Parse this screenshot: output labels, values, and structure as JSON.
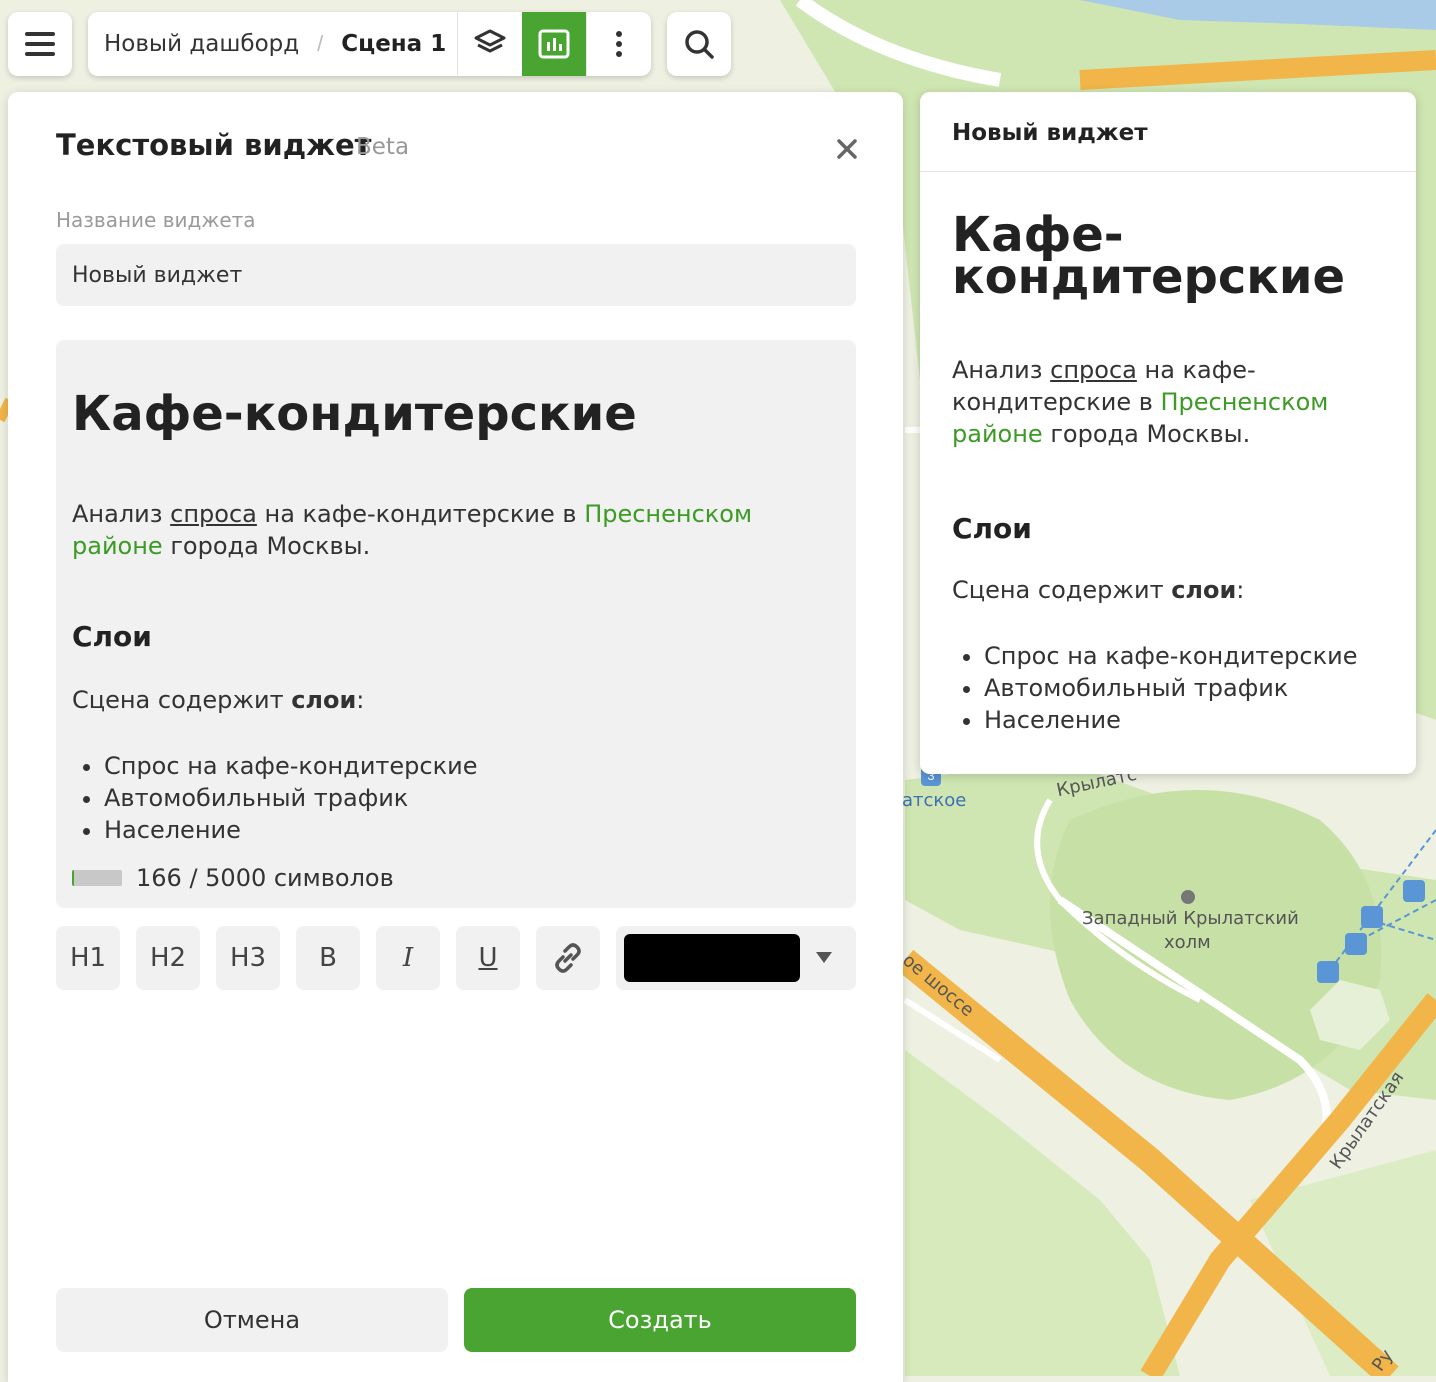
{
  "topbar": {
    "breadcrumb_dashboard": "Новый дашборд",
    "breadcrumb_separator": "/",
    "breadcrumb_scene": "Сцена 1"
  },
  "icons": {
    "menu": "menu-icon",
    "layers": "layers-icon",
    "widgets": "chart-icon",
    "more": "more-vertical-icon",
    "search": "search-icon",
    "close": "close-icon",
    "link": "link-icon",
    "dropdown": "chevron-down-icon"
  },
  "colors": {
    "accent": "#4aa431",
    "link": "#3d9a26",
    "selected_text_color": "#000000"
  },
  "editor_panel": {
    "title": "Текстовый виджет",
    "badge": "Beta",
    "name_label": "Название виджета",
    "name_value": "Новый виджет",
    "content": {
      "h1": "Кафе-кондитерские",
      "p1_before": "Анализ ",
      "p1_underlined": "спроса",
      "p1_middle": " на кафе-кондитерские в ",
      "p1_link": "Пресненском районе",
      "p1_after": " города Москвы.",
      "h2": "Слои",
      "p2_before": "Сцена содержит ",
      "p2_bold": "слои",
      "p2_after": ":",
      "list": [
        "Спрос на кафе-кондитерские",
        "Автомобильный трафик",
        "Население"
      ]
    },
    "counter_text": "166 / 5000 символов",
    "counter_fill_fraction": 0.0332,
    "toolbar": {
      "h1": "H1",
      "h2": "H2",
      "h3": "H3",
      "bold": "B",
      "italic": "I",
      "underline": "U"
    },
    "cancel_label": "Отмена",
    "create_label": "Создать"
  },
  "preview": {
    "title": "Новый виджет",
    "h1": "Кафе-кондитерские",
    "p1_before": "Анализ ",
    "p1_underlined": "спроса",
    "p1_middle": " на кафе-кондитерские в ",
    "p1_link": "Пресненском районе",
    "p1_after": " города Москвы.",
    "h2": "Слои",
    "p2_before": "Сцена содержит ",
    "p2_bold": "слои",
    "p2_after": ":",
    "list": [
      "Спрос на кафе-кондитерские",
      "Автомобильный трафик",
      "Население"
    ]
  },
  "map": {
    "label_krylatskoe": "атское",
    "label_krylatskaya_top": "Крылатс",
    "label_hill_1": "Западный Крылатский",
    "label_hill_2": "холм",
    "label_highway": "ое шоссе",
    "label_street": "Крылатская",
    "label_street_edge": "Ру",
    "metro_line": "3"
  }
}
